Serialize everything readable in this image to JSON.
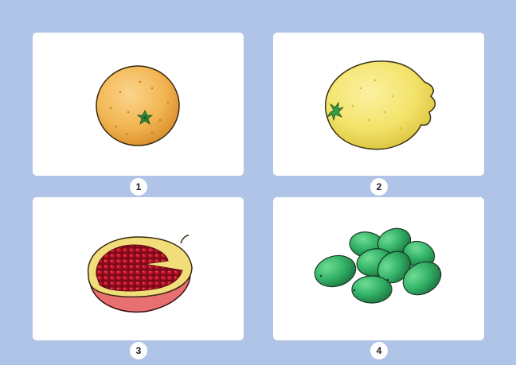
{
  "options": [
    {
      "label": "1",
      "icon": "orange-icon"
    },
    {
      "label": "2",
      "icon": "lemon-icon"
    },
    {
      "label": "3",
      "icon": "pomegranate-half-icon"
    },
    {
      "label": "4",
      "icon": "green-olives-icon"
    }
  ],
  "colors": {
    "background": "#afc4e6",
    "card": "#ffffff",
    "orange": "#f2b552",
    "lemon": "#f3e36a",
    "pomegranate_seeds": "#b3122a",
    "olives": "#35b56a"
  }
}
